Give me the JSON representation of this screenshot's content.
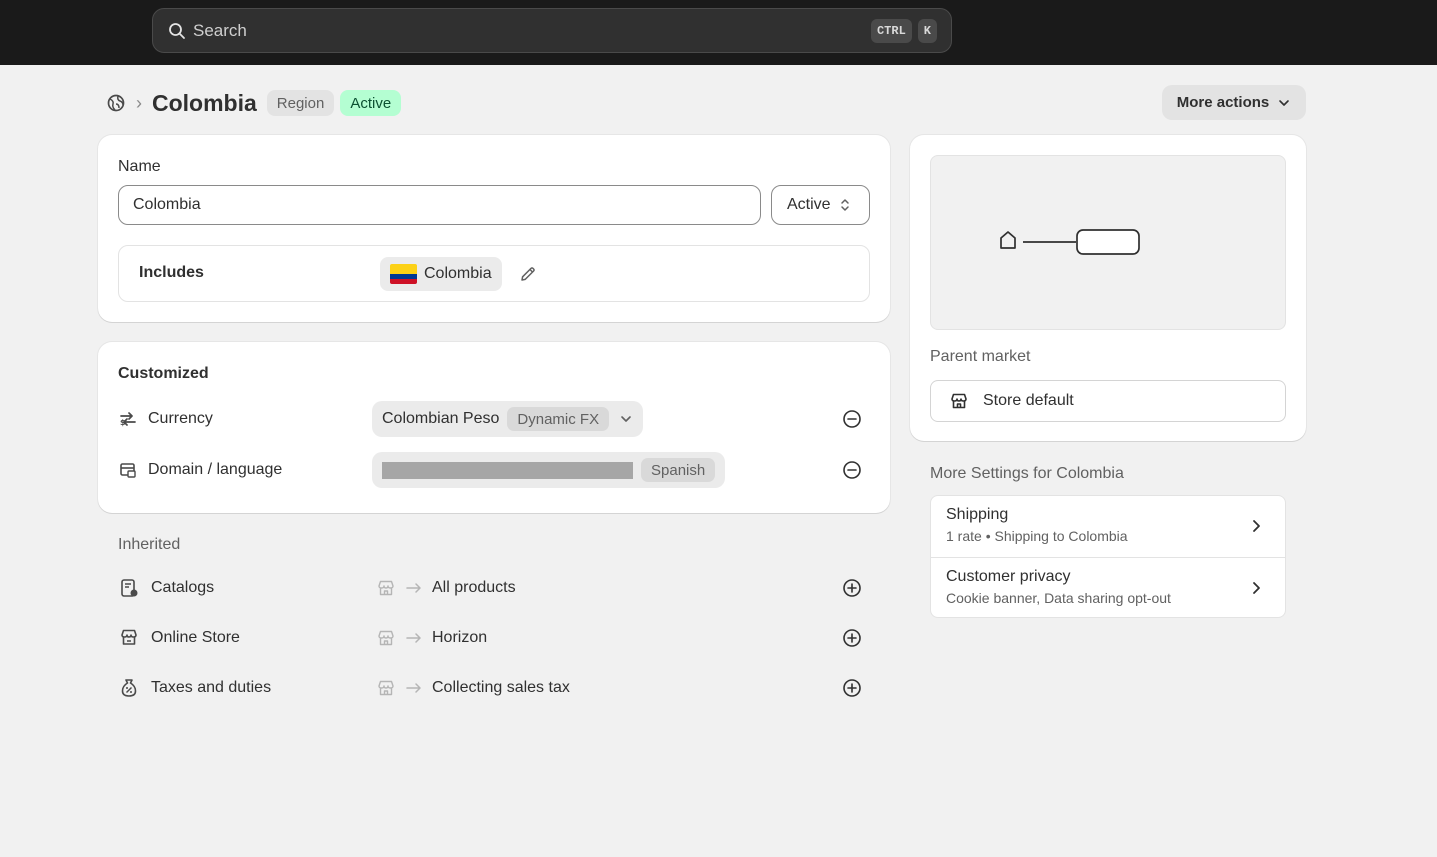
{
  "search": {
    "placeholder": "Search",
    "shortcut_1": "CTRL",
    "shortcut_2": "K"
  },
  "header": {
    "title": "Colombia",
    "badge_type": "Region",
    "badge_status": "Active",
    "more_actions": "More actions"
  },
  "general": {
    "name_label": "Name",
    "name_value": "Colombia",
    "status_value": "Active",
    "includes_label": "Includes",
    "includes_country": "Colombia"
  },
  "customized": {
    "title": "Customized",
    "currency_label": "Currency",
    "currency_value": "Colombian Peso",
    "currency_badge": "Dynamic FX",
    "domain_label": "Domain / language",
    "domain_badge": "Spanish"
  },
  "inherited": {
    "title": "Inherited",
    "rows": [
      {
        "label": "Catalogs",
        "value": "All products",
        "icon": "catalog-icon"
      },
      {
        "label": "Online Store",
        "value": "Horizon",
        "icon": "online-store-icon"
      },
      {
        "label": "Taxes and duties",
        "value": "Collecting sales tax",
        "icon": "tax-icon"
      }
    ]
  },
  "parent": {
    "label": "Parent market",
    "value": "Store default"
  },
  "more_settings": {
    "title": "More Settings for Colombia",
    "items": [
      {
        "title": "Shipping",
        "subtitle": "1 rate • Shipping to Colombia"
      },
      {
        "title": "Customer privacy",
        "subtitle": "Cookie banner, Data sharing opt-out"
      }
    ]
  },
  "colors": {
    "topbar": "#1a1a1a",
    "active_badge_bg": "#b4fed2",
    "active_badge_text": "#0c5132"
  }
}
